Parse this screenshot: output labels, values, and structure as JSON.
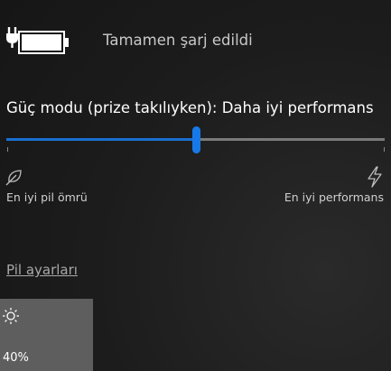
{
  "battery": {
    "icon": "battery-plugged-icon",
    "status": "Tamamen şarj edildi",
    "level": 1.0
  },
  "power_mode": {
    "title": "Güç modu (prize takılıyken): Daha iyi performans",
    "slider_value": 0.5,
    "accent_color": "#1779e8",
    "min_label": "En iyi pil ömrü",
    "max_label": "En iyi performans",
    "min_icon": "leaf-icon",
    "max_icon": "lightning-bolt-icon"
  },
  "links": {
    "battery_settings": "Pil ayarları"
  },
  "brightness_tile": {
    "icon": "sun-icon",
    "value": "40%"
  }
}
